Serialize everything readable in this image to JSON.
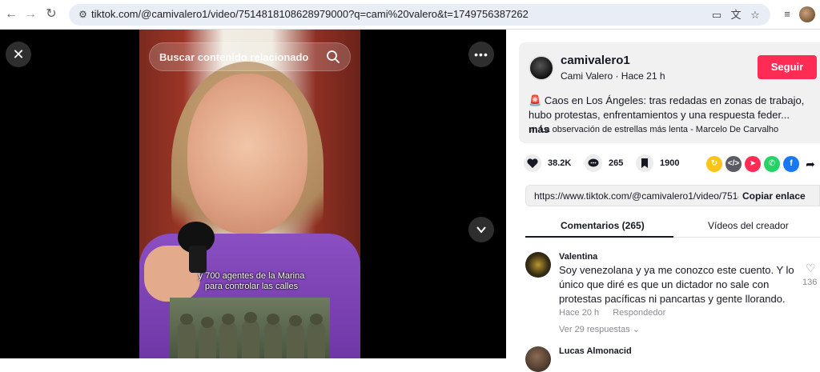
{
  "browser": {
    "url": "tiktok.com/@camivalero1/video/7514818108628979000?q=cami%20valero&t=1749756387262",
    "icons": [
      "back-arrow-icon",
      "forward-arrow-icon",
      "reload-icon",
      "site-info-icon",
      "cast-icon",
      "translate-icon",
      "bookmark-star-icon",
      "media-icon",
      "profile-avatar"
    ]
  },
  "video": {
    "search_placeholder": "Buscar contenido relacionado",
    "caption_line1": "y 700 agentes de la Marina",
    "caption_line2": "para controlar las calles"
  },
  "creator": {
    "username": "camivalero1",
    "display_name": "Cami Valero",
    "time": "Hace 21 h",
    "subline": "Cami Valero · Hace 21 h",
    "follow_label": "Seguir",
    "description_emoji": "🚨",
    "description": "Caos en Los Ángeles: tras redadas en zonas de trabajo, hubo protestas, enfrentamientos y una respuesta feder...",
    "more_label": "más",
    "music": "La observación de estrellas más lenta - Marcelo De Carvalho"
  },
  "stats": {
    "likes": "38.2K",
    "comments": "265",
    "saves": "1900"
  },
  "share": {
    "link": "https://www.tiktok.com/@camivalero1/video/7514...",
    "copy_label": "Copiar enlace"
  },
  "tabs": {
    "comments": "Comentarios (265)",
    "creator_videos": "Vídeos del creador"
  },
  "comments": [
    {
      "name": "Valentina",
      "text": "Soy venezolana y ya me conozco este cuento. Y lo único que diré es que un dictador no sale con protestas pacíficas ni pancartas y gente llorando.",
      "time": "Hace 20 h",
      "reply_label": "Respondedor",
      "replies": "Ver 29 respuestas",
      "likes": "136"
    },
    {
      "name": "Lucas Almonacid"
    }
  ],
  "colors": {
    "accent": "#fe2c55",
    "text": "#161823",
    "muted": "#8a8b91"
  }
}
